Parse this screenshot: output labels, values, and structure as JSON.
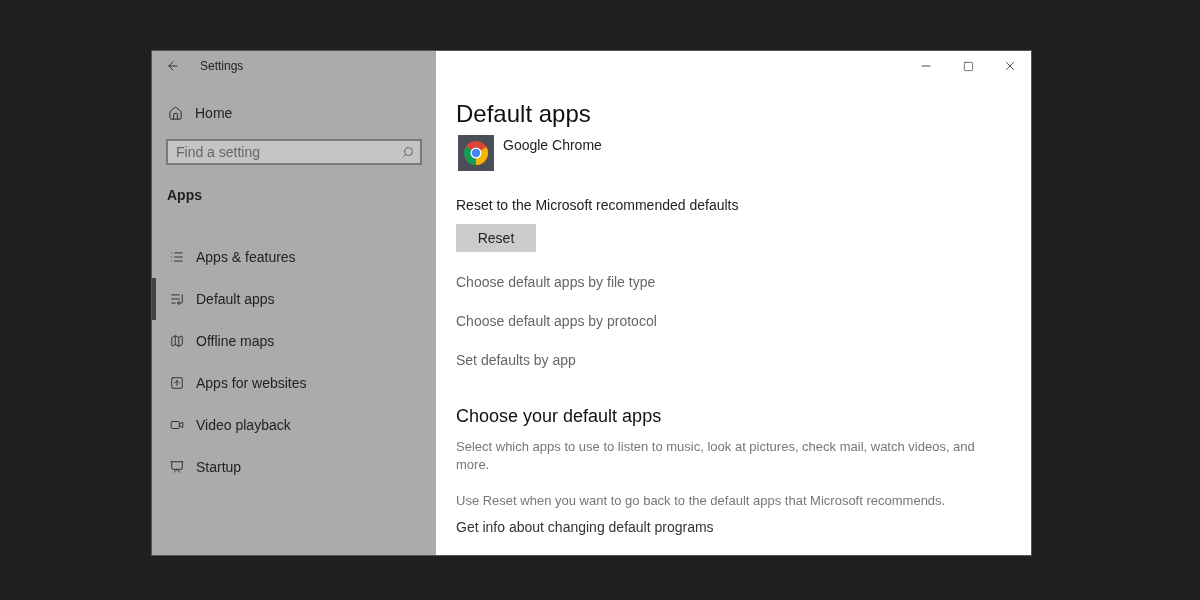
{
  "window": {
    "title": "Settings"
  },
  "sidebar": {
    "home": "Home",
    "search": {
      "placeholder": "Find a setting"
    },
    "section": "Apps",
    "items": [
      {
        "label": "Apps & features",
        "selected": false
      },
      {
        "label": "Default apps",
        "selected": true
      },
      {
        "label": "Offline maps",
        "selected": false
      },
      {
        "label": "Apps for websites",
        "selected": false
      },
      {
        "label": "Video playback",
        "selected": false
      },
      {
        "label": "Startup",
        "selected": false
      }
    ]
  },
  "content": {
    "title": "Default apps",
    "app": "Google Chrome",
    "reset_label": "Reset to the Microsoft recommended defaults",
    "reset_button": "Reset",
    "links": [
      "Choose default apps by file type",
      "Choose default apps by protocol",
      "Set defaults by app"
    ],
    "section_title": "Choose your default apps",
    "description": "Select which apps to use to listen to music, look at pictures, check mail, watch videos, and more.",
    "note": "Use Reset when you want to go back to the default apps that Microsoft recommends.",
    "info_link": "Get info about changing default programs"
  }
}
